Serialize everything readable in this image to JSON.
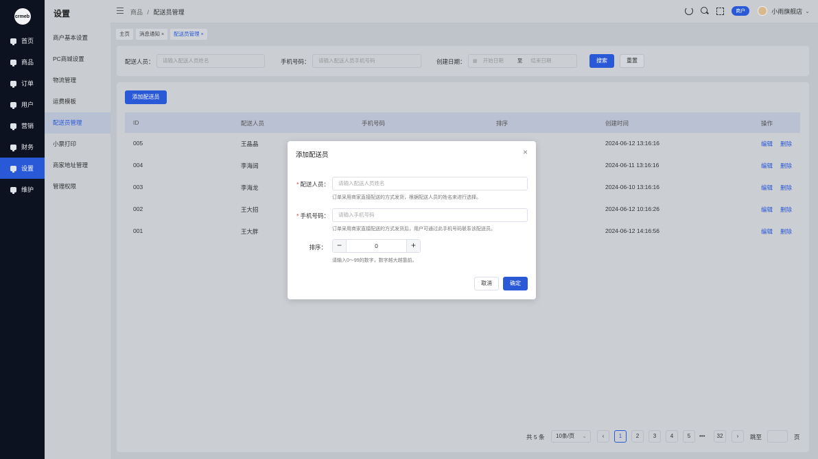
{
  "nav": {
    "logo": "crmeb",
    "items": [
      {
        "label": "首页"
      },
      {
        "label": "商品"
      },
      {
        "label": "订单"
      },
      {
        "label": "用户"
      },
      {
        "label": "营销"
      },
      {
        "label": "财务"
      },
      {
        "label": "设置"
      },
      {
        "label": "维护"
      }
    ],
    "active_index": 6
  },
  "submenu": {
    "title": "设置",
    "items": [
      {
        "label": "商户基本设置"
      },
      {
        "label": "PC商城设置"
      },
      {
        "label": "物流管理"
      },
      {
        "label": "运费模板"
      },
      {
        "label": "配送员管理"
      },
      {
        "label": "小票打印"
      },
      {
        "label": "商家地址管理"
      },
      {
        "label": "管理权限"
      }
    ],
    "active_index": 4
  },
  "header": {
    "breadcrumb_parent": "商品",
    "breadcrumb_sep": "/",
    "breadcrumb_current": "配送员管理",
    "role_badge": "商户",
    "user_name": "小雨旗舰店"
  },
  "tabs": [
    {
      "label": "主页",
      "closable": false
    },
    {
      "label": "消息通知",
      "closable": true
    },
    {
      "label": "配送员管理",
      "closable": true
    }
  ],
  "filter": {
    "courier_label": "配送人员：",
    "courier_placeholder": "请输入配送人员姓名",
    "phone_label": "手机号码：",
    "phone_placeholder": "请输入配送人员手机号码",
    "date_label": "创建日期：",
    "date_start_placeholder": "开始日期",
    "date_sep": "至",
    "date_end_placeholder": "结束日期",
    "search_button": "搜索",
    "reset_button": "重置"
  },
  "table": {
    "add_button": "添加配送员",
    "columns": [
      "ID",
      "配送人员",
      "手机号码",
      "排序",
      "创建时间",
      "操作"
    ],
    "rows": [
      {
        "id": "005",
        "name": "王晶晶",
        "created": "2024-06-12 13:16:16"
      },
      {
        "id": "004",
        "name": "李海阔",
        "created": "2024-06-11 13:16:16"
      },
      {
        "id": "003",
        "name": "李海龙",
        "created": "2024-06-10 13:16:16"
      },
      {
        "id": "002",
        "name": "王大招",
        "created": "2024-06-12 10:16:26"
      },
      {
        "id": "001",
        "name": "王大胖",
        "created": "2024-06-12 14:16:56"
      }
    ],
    "edit_label": "编辑",
    "delete_label": "删除"
  },
  "pager": {
    "total": "共 5 条",
    "page_size": "10条/页",
    "pages": [
      "1",
      "2",
      "3",
      "4",
      "5"
    ],
    "ellipsis": "•••",
    "last_page": "32",
    "current_page": "1",
    "jump_label": "跳至",
    "page_unit": "页",
    "prev": "‹",
    "next": "›"
  },
  "modal": {
    "title": "添加配送员",
    "close": "×",
    "courier_label": "配送人员：",
    "courier_placeholder": "请输入配送人员姓名",
    "courier_hint": "订单采用商家直接配送的方式发货，根据配送人员的姓名来进行选择。",
    "phone_label": "手机号码：",
    "phone_placeholder": "请输入手机号码",
    "phone_hint": "订单采用商家直接配送的方式发货后，用户可通过此手机号码联系该配送员。",
    "sort_label": "排序：",
    "sort_value": "0",
    "sort_minus": "−",
    "sort_plus": "+",
    "sort_hint": "请输入0～99的数字，数字越大越靠前。",
    "cancel_button": "取消",
    "confirm_button": "确定",
    "required_mark": "*"
  }
}
